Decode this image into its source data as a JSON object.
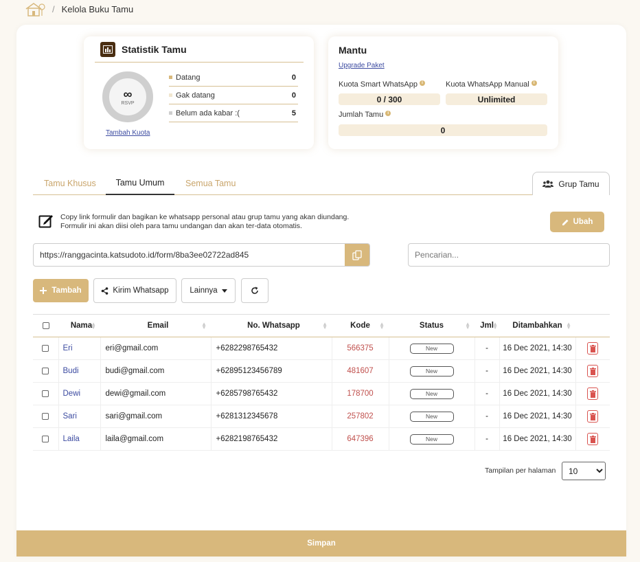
{
  "breadcrumb": {
    "separator": "/",
    "current": "Kelola Buku Tamu"
  },
  "stats": {
    "title": "Statistik Tamu",
    "donut_symbol": "∞",
    "donut_label": "RSVP",
    "tambah_kuota": "Tambah Kuota",
    "legend": [
      {
        "label": "Datang",
        "value": "0",
        "color": "#d8b87c"
      },
      {
        "label": "Gak datang",
        "value": "0",
        "color": "#f1e6cf"
      },
      {
        "label": "Belum ada kabar :(",
        "value": "5",
        "color": "#cfcfcf"
      }
    ]
  },
  "mantu": {
    "title": "Mantu",
    "upgrade": "Upgrade Paket",
    "smart_label": "Kuota Smart WhatsApp",
    "smart_value": "0 / 300",
    "manual_label": "Kuota WhatsApp Manual",
    "manual_value": "Unlimited",
    "jumlah_label": "Jumlah Tamu",
    "jumlah_value": "0",
    "info_glyph": "i"
  },
  "tabs": {
    "khusus": "Tamu Khusus",
    "umum": "Tamu Umum",
    "semua": "Semua Tamu",
    "grup": "Grup Tamu"
  },
  "form_info": {
    "line1": "Copy link formulir dan bagikan ke whatsapp personal atau grup tamu yang akan diundang.",
    "line2": "Formulir ini akan diisi oleh para tamu undangan dan akan ter-data otomatis.",
    "ubah": "Ubah"
  },
  "url": "https://ranggacinta.katsudoto.id/form/8ba3ee02722ad845",
  "search_placeholder": "Pencarian...",
  "toolbar": {
    "tambah": "Tambah",
    "kirim": "Kirim Whatsapp",
    "lainnya": "Lainnya"
  },
  "table": {
    "headers": {
      "nama": "Nama",
      "email": "Email",
      "wa": "No. Whatsapp",
      "kode": "Kode",
      "status": "Status",
      "jml": "Jml",
      "date": "Ditambahkan"
    },
    "rows": [
      {
        "nama": "Eri",
        "email": "eri@gmail.com",
        "wa": "+6282298765432",
        "kode": "566375",
        "status": "New",
        "jml": "-",
        "date": "16 Dec 2021, 14:30"
      },
      {
        "nama": "Budi",
        "email": "budi@gmail.com",
        "wa": "+62895123456789",
        "kode": "481607",
        "status": "New",
        "jml": "-",
        "date": "16 Dec 2021, 14:30"
      },
      {
        "nama": "Dewi",
        "email": "dewi@gmail.com",
        "wa": "+6285798765432",
        "kode": "178700",
        "status": "New",
        "jml": "-",
        "date": "16 Dec 2021, 14:30"
      },
      {
        "nama": "Sari",
        "email": "sari@gmail.com",
        "wa": "+6281312345678",
        "kode": "257802",
        "status": "New",
        "jml": "-",
        "date": "16 Dec 2021, 14:30"
      },
      {
        "nama": "Laila",
        "email": "laila@gmail.com",
        "wa": "+6282198765432",
        "kode": "647396",
        "status": "New",
        "jml": "-",
        "date": "16 Dec 2021, 14:30"
      }
    ]
  },
  "pagination": {
    "label": "Tampilan per halaman",
    "value": "10"
  },
  "simpan": "Simpan",
  "colors": {
    "accent": "#d8b87c",
    "link": "#3b4aa0",
    "code": "#c0504d",
    "danger": "#d9534f"
  }
}
